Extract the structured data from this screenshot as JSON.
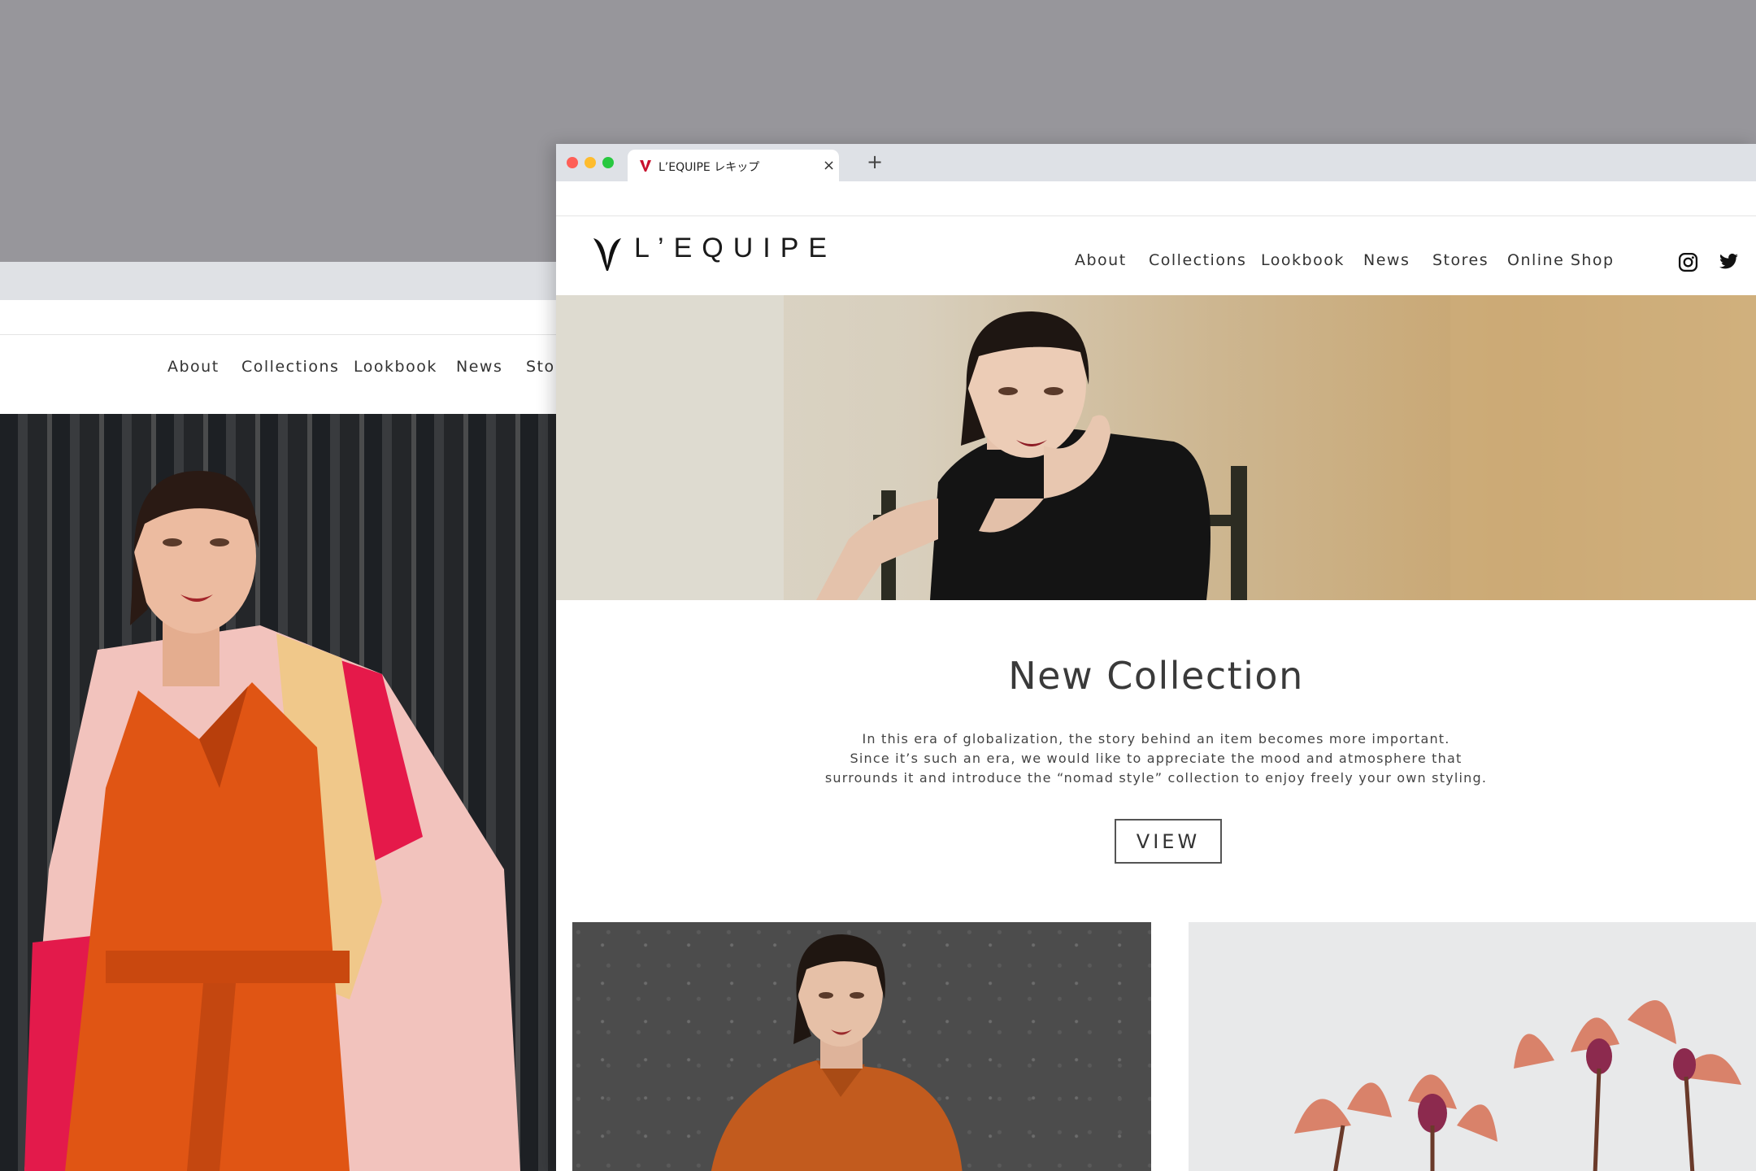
{
  "back_window": {
    "nav": [
      "About",
      "Collections",
      "Lookbook",
      "News",
      "Stor"
    ]
  },
  "front_window": {
    "tab": {
      "title": "L’EQUIPE レキップ",
      "close": "×",
      "new_tab": "+"
    },
    "site": {
      "logo_text": "L’EQUIPE",
      "nav": [
        "About",
        "Collections",
        "Lookbook",
        "News",
        "Stores",
        "Online Shop"
      ],
      "social": [
        "instagram-icon",
        "twitter-icon"
      ]
    },
    "section": {
      "title": "New Collection",
      "body_lines": [
        "In this era of globalization, the story behind an item becomes more important.",
        "Since it’s such an era, we would like to appreciate the mood and atmosphere that",
        "surrounds it and introduce the “nomad style” collection to enjoy freely your own styling."
      ],
      "button": "VIEW"
    }
  },
  "colors": {
    "brand_red": "#c8102e",
    "traffic_red": "#fe5f57",
    "traffic_yellow": "#febc2e",
    "traffic_green": "#28c840"
  }
}
